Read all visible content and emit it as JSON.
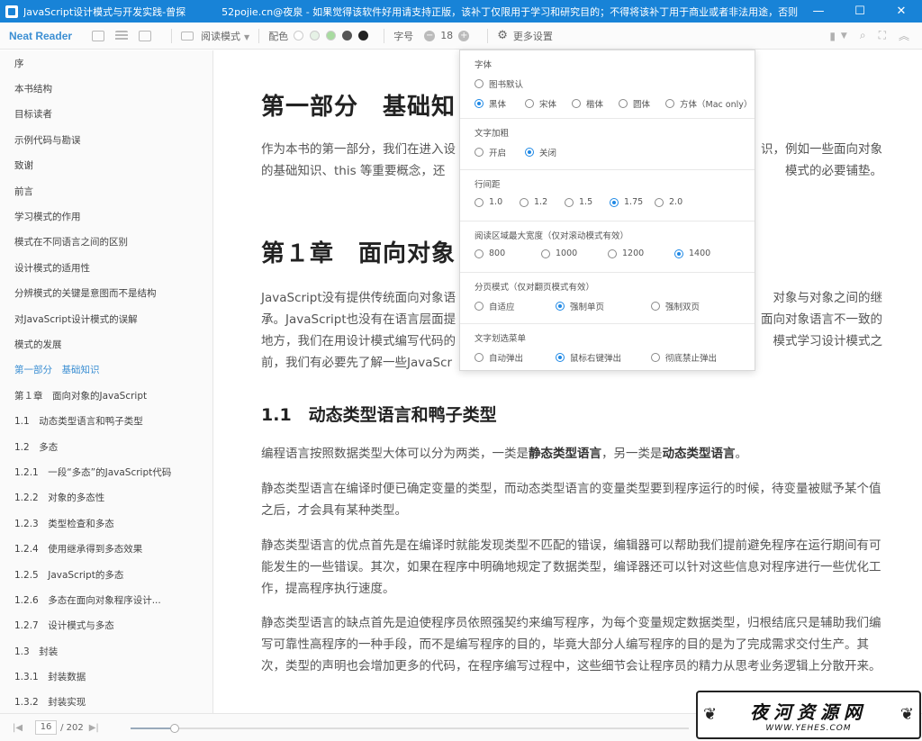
{
  "titlebar": {
    "title": "JavaScript设计模式与开发实践-曾探",
    "site": "52pojie.cn@夜泉 - 如果觉得该软件好用请支持正版，该补丁仅限用于学习和研究目的；不得将该补丁用于商业或者非法用途，否则，一切后果请用户自负！",
    "minimize": "—",
    "maximize": "☐",
    "close": "✕"
  },
  "toolbar": {
    "brand": "Neat Reader",
    "read_mode": "阅读模式",
    "color_label": "配色",
    "swatches": [
      "#ffffff",
      "#e6f2e6",
      "#a8dba0",
      "#555555",
      "#222222"
    ],
    "font_size_label": "字号",
    "font_size_value": "18",
    "minus": "−",
    "plus": "+",
    "more_settings": "更多设置"
  },
  "sidebar": {
    "items": [
      "序",
      "本书结构",
      "目标读者",
      "示例代码与勘误",
      "致谢",
      "前言",
      "学习模式的作用",
      "模式在不同语言之间的区别",
      "设计模式的适用性",
      "分辨模式的关键是意图而不是结构",
      "对JavaScript设计模式的误解",
      "模式的发展",
      "第一部分　基础知识",
      "第１章　面向对象的JavaScript",
      "1.1　动态类型语言和鸭子类型",
      "1.2　多态",
      "1.2.1　一段“多态”的JavaScript代码",
      "1.2.2　对象的多态性",
      "1.2.3　类型检查和多态",
      "1.2.4　使用继承得到多态效果",
      "1.2.5　JavaScript的多态",
      "1.2.6　多态在面向对象程序设计...",
      "1.2.7　设计模式与多态",
      "1.3　封装",
      "1.3.1　封装数据",
      "1.3.2　封装实现"
    ],
    "active_index": 12
  },
  "article": {
    "part_title": "第一部分　基础知",
    "intro_line1": "作为本书的第一部分，我们在进入设",
    "intro_line1_tail": "识，例如一些面向对象",
    "intro_line2": "的基础知识、this 等重要概念，还",
    "intro_line2_tail": "模式的必要铺垫。",
    "chapter_title": "第１章　面向对象",
    "ch_line1": "JavaScript没有提供传统面向对象语",
    "ch_line1_tail": "对象与对象之间的继",
    "ch_line2": "承。JavaScript也没有在语言层面提",
    "ch_line2_tail": "面向对象语言不一致的",
    "ch_line3": "地方，我们在用设计模式编写代码的",
    "ch_line3_tail": "模式学习设计模式之",
    "ch_line4": "前，我们有必要先了解一些JavaScr",
    "section_title": "1.1　动态类型语言和鸭子类型",
    "p1_a": "编程语言按照数据类型大体可以分为两类，一类是",
    "p1_b": "静态类型语言",
    "p1_c": "，另一类是",
    "p1_d": "动态类型语言",
    "p1_e": "。",
    "p2": "静态类型语言在编译时便已确定变量的类型，而动态类型语言的变量类型要到程序运行的时候，待变量被赋予某个值之后，才会具有某种类型。",
    "p3": "静态类型语言的优点首先是在编译时就能发现类型不匹配的错误，编辑器可以帮助我们提前避免程序在运行期间有可能发生的一些错误。其次，如果在程序中明确地规定了数据类型，编译器还可以针对这些信息对程序进行一些优化工作，提高程序执行速度。",
    "p4": "静态类型语言的缺点首先是迫使程序员依照强契约来编写程序，为每个变量规定数据类型，归根结底只是辅助我们编写可靠性高程序的一种手段，而不是编写程序的目的，毕竟大部分人编写程序的目的是为了完成需求交付生产。其次，类型的声明也会增加更多的代码，在程序编写过程中，这些细节会让程序员的精力从思考业务逻辑上分散开来。"
  },
  "popup": {
    "groups": [
      {
        "title": "字体",
        "rows": [
          [
            "图书默认"
          ],
          [
            "黑体",
            "宋体",
            "楷体",
            "圆体",
            "方体（Mac only）"
          ]
        ],
        "selected": "黑体"
      },
      {
        "title": "文字加粗",
        "rows": [
          [
            "开启",
            "关闭"
          ]
        ],
        "selected": "关闭"
      },
      {
        "title": "行间距",
        "rows": [
          [
            "1.0",
            "1.2",
            "1.5",
            "1.75",
            "2.0"
          ]
        ],
        "selected": "1.75"
      },
      {
        "title": "阅读区域最大宽度（仅对滚动模式有效）",
        "rows": [
          [
            "800",
            "1000",
            "1200",
            "1400"
          ]
        ],
        "selected": "1400"
      },
      {
        "title": "分页模式（仅对翻页模式有效）",
        "rows": [
          [
            "自适应",
            "强制单页",
            "强制双页"
          ]
        ],
        "selected": "强制单页"
      },
      {
        "title": "文字划选菜单",
        "rows": [
          [
            "自动弹出",
            "鼠标右键弹出",
            "彻底禁止弹出"
          ]
        ],
        "selected": "鼠标右键弹出"
      }
    ]
  },
  "bottombar": {
    "page_current": "16",
    "page_total": "/ 202",
    "progress": 0.079
  },
  "watermark": {
    "main": "夜河资源网",
    "url": "WWW.YEHES.COM"
  }
}
